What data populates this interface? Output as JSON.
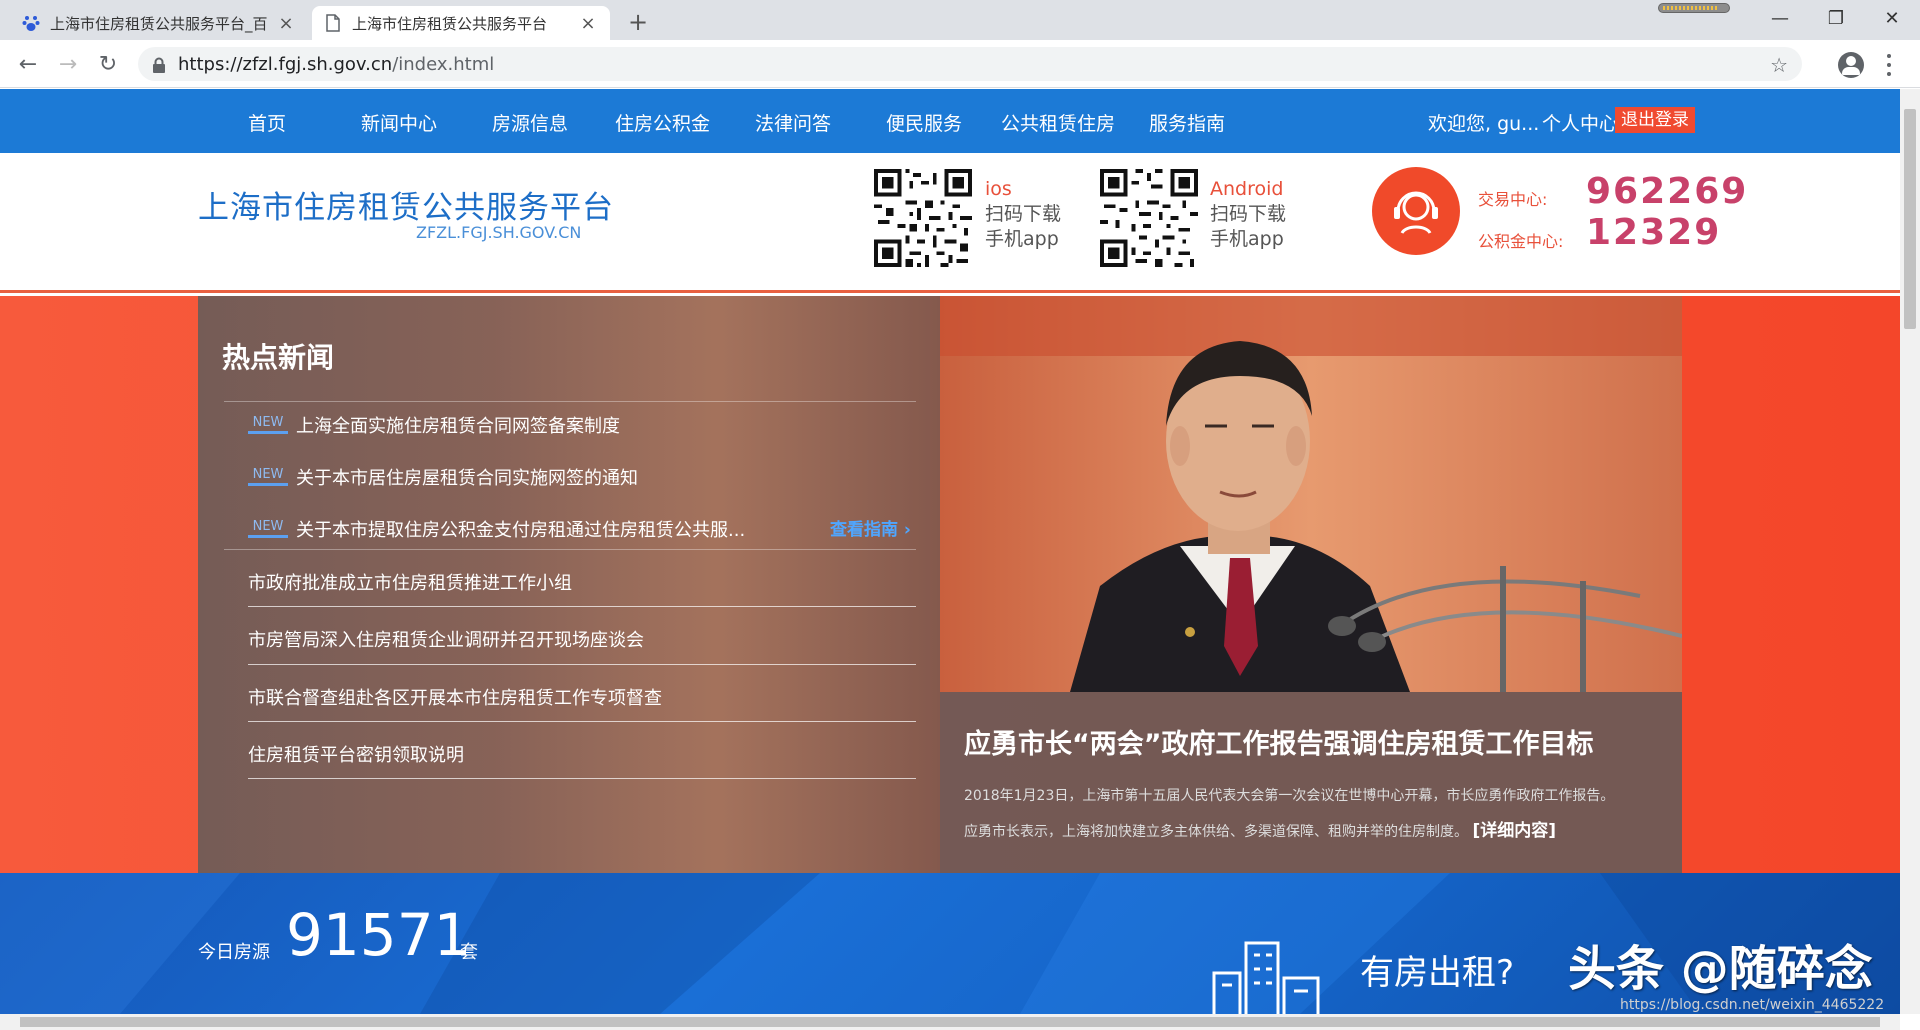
{
  "browser": {
    "tabs": [
      {
        "title": "上海市住房租赁公共服务平台_百",
        "icon": "paw-icon"
      },
      {
        "title": "上海市住房租赁公共服务平台",
        "icon": "document-icon"
      }
    ],
    "url_base": "https://zfzl.fgj.sh.gov.cn",
    "url_path": "/index.html"
  },
  "nav": {
    "items": [
      "首页",
      "新闻中心",
      "房源信息",
      "住房公积金",
      "法律问答",
      "便民服务",
      "公共租赁住房",
      "服务指南"
    ],
    "welcome": "欢迎您, gu...",
    "user_center": "个人中心",
    "logout": "退出登录",
    "bg_color": "#1c7ad6"
  },
  "header": {
    "title": "上海市住房租赁公共服务平台",
    "subtitle": "ZFZL.FGJ.SH.GOV.CN",
    "apps": [
      {
        "os": "ios",
        "line1": "扫码下载",
        "line2": "手机app"
      },
      {
        "os": "Android",
        "line1": "扫码下载",
        "line2": "手机app"
      }
    ],
    "hotlines": [
      {
        "label": "交易中心:",
        "number": "962269"
      },
      {
        "label": "公积金中心:",
        "number": "12329"
      }
    ]
  },
  "news": {
    "heading": "热点新闻",
    "new_badge": "NEW",
    "new_items": [
      "上海全面实施住房租赁合同网签备案制度",
      "关于本市居住房屋租赁合同实施网签的通知",
      "关于本市提取住房公积金支付房租通过住房租赁公共服..."
    ],
    "guide_link": "查看指南",
    "items": [
      "市政府批准成立市住房租赁推进工作小组",
      "市房管局深入住房租赁企业调研并召开现场座谈会",
      "市联合督查组赴各区开展本市住房租赁工作专项督查",
      "住房租赁平台密钥领取说明"
    ]
  },
  "feature": {
    "title": "应勇市长“两会”政府工作报告强调住房租赁工作目标",
    "line1": "2018年1月23日，上海市第十五届人民代表大会第一次会议在世博中心开幕，市长应勇作政府工作报告。",
    "line2": "应勇市长表示，上海将加快建立多主体供给、多渠道保障、租购并举的住房制度。",
    "more": "[详细内容]"
  },
  "stats": {
    "label": "今日房源",
    "count": "91571",
    "unit": "套",
    "rent_question": "有房出租?"
  },
  "overlay": {
    "watermark": "头条 @随碎念",
    "small": "https://blog.csdn.net/weixin_4465222"
  }
}
